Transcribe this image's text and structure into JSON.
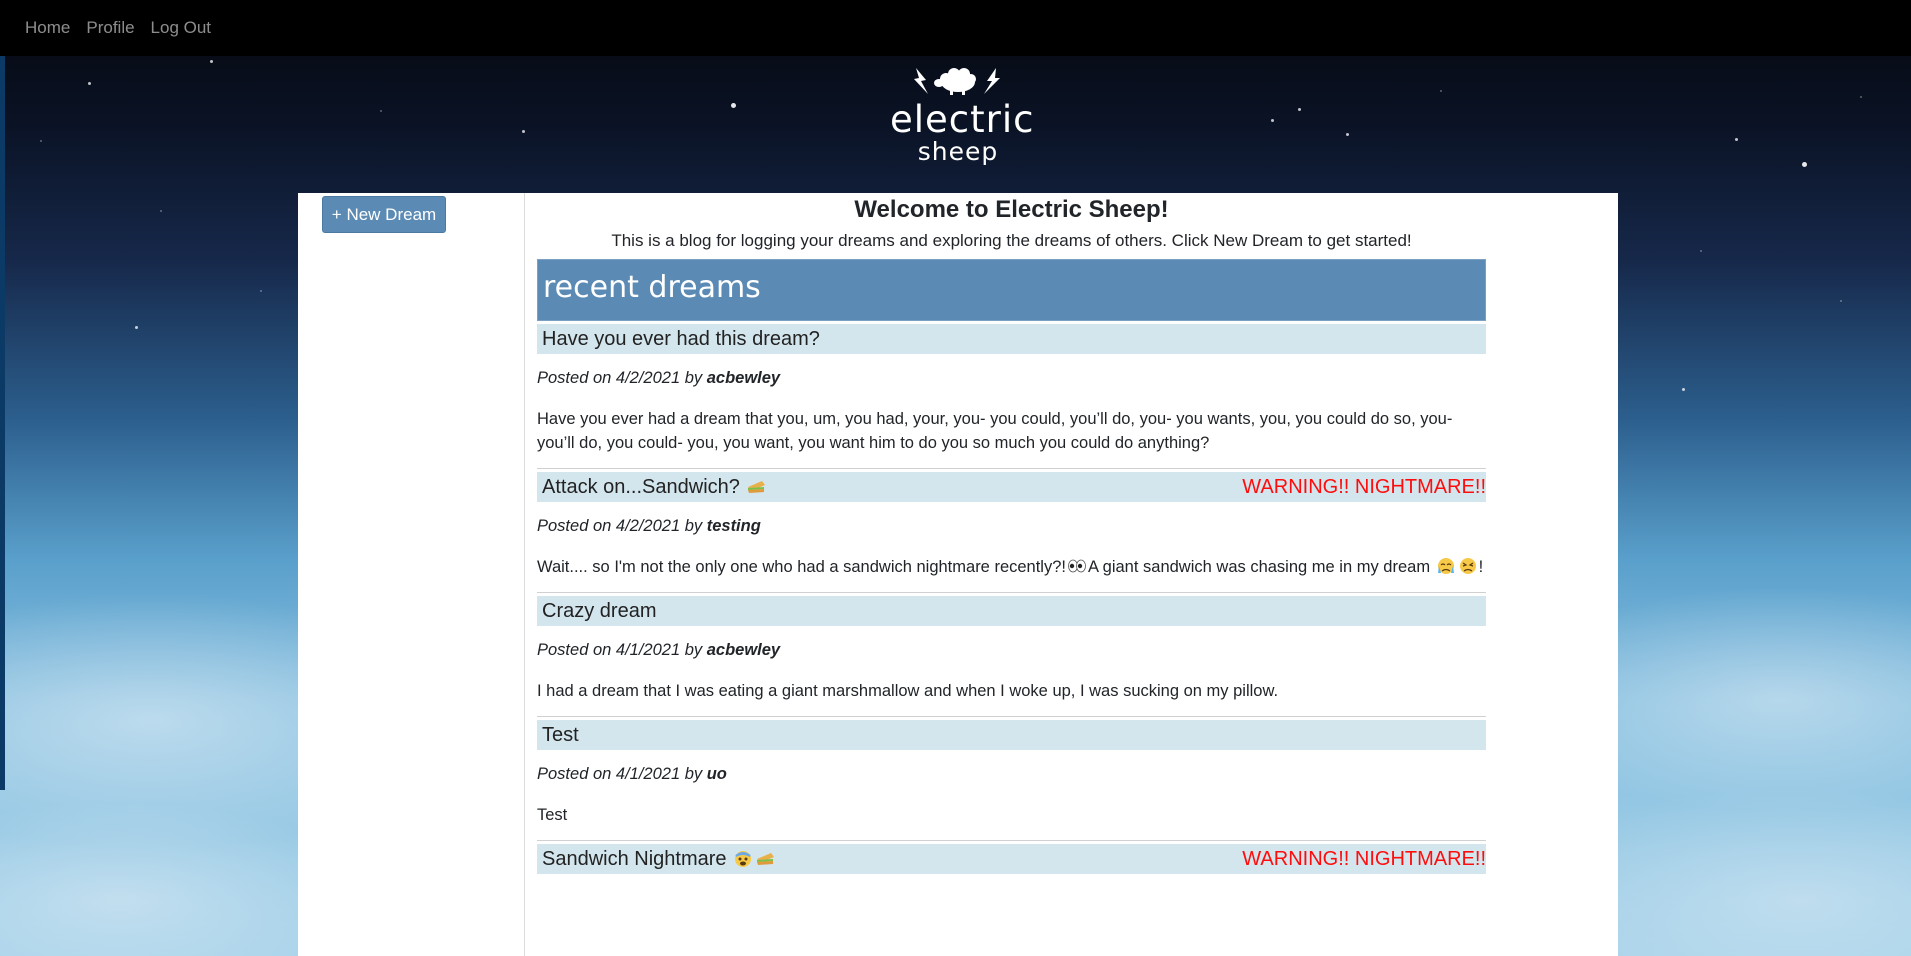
{
  "nav": {
    "items": [
      {
        "label": "Home"
      },
      {
        "label": "Profile"
      },
      {
        "label": "Log Out"
      }
    ]
  },
  "logo": {
    "line1": "electric",
    "line2": "sheep"
  },
  "sidebar": {
    "new_dream_label": "+ New Dream"
  },
  "welcome": {
    "title": "Welcome to Electric Sheep!",
    "text": "This is a blog for logging your dreams and exploring the dreams of others. Click New Dream to get started!"
  },
  "recent": {
    "header": "recent dreams"
  },
  "dreams": [
    {
      "title": "Have you ever had this dream?",
      "warning": "",
      "meta_prefix": "Posted on 4/2/2021 by ",
      "author": "acbewley",
      "body": "Have you ever had a dream that you, um, you had, your, you- you could, you’ll do, you- you wants, you, you could do so, you- you’ll do, you could- you, you want, you want him to do you so much you could do anything?"
    },
    {
      "title": "Attack on...Sandwich?",
      "title_icons": [
        "sandwich-icon"
      ],
      "warning": "WARNING!! NIGHTMARE!!",
      "meta_prefix": "Posted on 4/2/2021 by ",
      "author": "testing",
      "body_part1": "Wait.... so I'm not the only one who had a sandwich nightmare recently?!",
      "body_part2": "A giant sandwich was chasing me in my dream",
      "body_part3": "!"
    },
    {
      "title": "Crazy dream",
      "warning": "",
      "meta_prefix": "Posted on 4/1/2021 by ",
      "author": "acbewley",
      "body": "I had a dream that I was eating a giant marshmallow and when I woke up, I was sucking on my pillow."
    },
    {
      "title": "Test",
      "warning": "",
      "meta_prefix": "Posted on 4/1/2021 by ",
      "author": "uo",
      "body": "Test"
    },
    {
      "title": "Sandwich Nightmare",
      "title_icons": [
        "fearful-face-icon",
        "sandwich-icon"
      ],
      "warning": "WARNING!! NIGHTMARE!!"
    }
  ],
  "colors": {
    "navbar": "#000000",
    "primary": "#5b8bb5",
    "title_bar": "#d3e6ee",
    "warning": "#ff0d0d"
  }
}
